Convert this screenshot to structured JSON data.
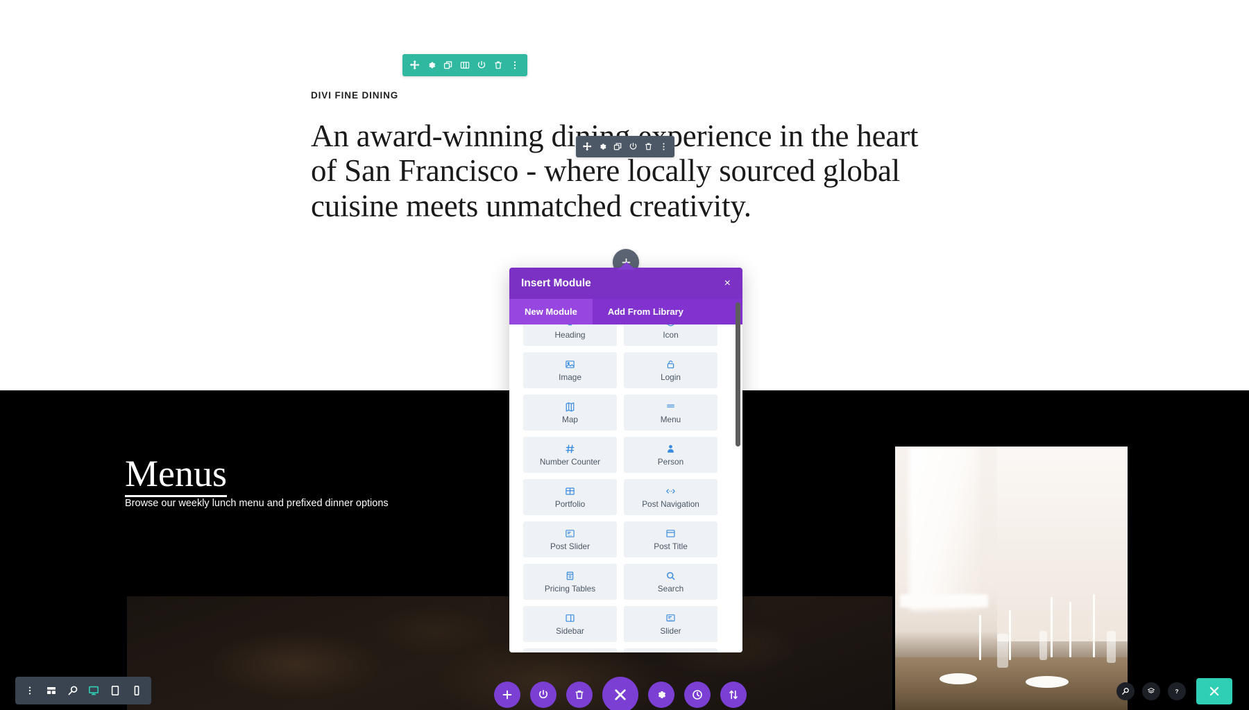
{
  "hero": {
    "eyebrow": "DIVI FINE DINING",
    "headline": "An award-winning dining experience in the heart of San Francisco - where locally sourced global cuisine meets unmatched creativity."
  },
  "dark_section": {
    "title": "Menus",
    "subtitle": "Browse our weekly lunch menu and prefixed dinner options"
  },
  "section_toolbar": {
    "buttons": [
      {
        "icon": "move-icon",
        "label": "Move Section"
      },
      {
        "icon": "gear-icon",
        "label": "Section Settings"
      },
      {
        "icon": "duplicate-icon",
        "label": "Duplicate Section"
      },
      {
        "icon": "columns-icon",
        "label": "Column Structure"
      },
      {
        "icon": "power-icon",
        "label": "Disable Section"
      },
      {
        "icon": "trash-icon",
        "label": "Delete Section"
      },
      {
        "icon": "more-options-icon",
        "label": "More Options"
      }
    ]
  },
  "module_toolbar": {
    "buttons": [
      {
        "icon": "move-icon",
        "label": "Move Module"
      },
      {
        "icon": "gear-icon",
        "label": "Module Settings"
      },
      {
        "icon": "duplicate-icon",
        "label": "Duplicate Module"
      },
      {
        "icon": "power-icon",
        "label": "Disable Module"
      },
      {
        "icon": "trash-icon",
        "label": "Delete Module"
      },
      {
        "icon": "more-options-icon",
        "label": "More Options"
      }
    ]
  },
  "add_module_button": {
    "icon": "plus-icon",
    "label": "Add New Module"
  },
  "modal": {
    "title": "Insert Module",
    "close_label": "×",
    "close_icon": "close-icon",
    "tabs": [
      {
        "label": "New Module",
        "active": true
      },
      {
        "label": "Add From Library",
        "active": false
      }
    ],
    "modules": [
      {
        "label": "Heading",
        "icon": "heading-icon"
      },
      {
        "label": "Icon",
        "icon": "icon-badge-icon"
      },
      {
        "label": "Image",
        "icon": "image-icon"
      },
      {
        "label": "Login",
        "icon": "lock-icon"
      },
      {
        "label": "Map",
        "icon": "map-icon"
      },
      {
        "label": "Menu",
        "icon": "hamburger-icon"
      },
      {
        "label": "Number Counter",
        "icon": "hash-icon"
      },
      {
        "label": "Person",
        "icon": "person-icon"
      },
      {
        "label": "Portfolio",
        "icon": "grid-icon"
      },
      {
        "label": "Post Navigation",
        "icon": "code-arrows-icon"
      },
      {
        "label": "Post Slider",
        "icon": "post-slider-icon"
      },
      {
        "label": "Post Title",
        "icon": "post-title-icon"
      },
      {
        "label": "Pricing Tables",
        "icon": "pricing-icon"
      },
      {
        "label": "Search",
        "icon": "search-icon"
      },
      {
        "label": "Sidebar",
        "icon": "sidebar-icon"
      },
      {
        "label": "Slider",
        "icon": "slider-icon"
      },
      {
        "label": "",
        "icon": "person-add-icon"
      },
      {
        "label": "",
        "icon": "window-icon"
      }
    ]
  },
  "bottom_left_toolbar": {
    "buttons": [
      {
        "icon": "vertical-dots-icon",
        "label": "More Settings"
      },
      {
        "icon": "wireframe-icon",
        "label": "Wireframe View"
      },
      {
        "icon": "zoom-out-icon",
        "label": "Zoom Out View"
      },
      {
        "icon": "desktop-icon",
        "label": "Desktop View",
        "active": true
      },
      {
        "icon": "tablet-icon",
        "label": "Tablet View"
      },
      {
        "icon": "phone-icon",
        "label": "Phone View"
      }
    ]
  },
  "bottom_center_toolbar": {
    "buttons": [
      {
        "icon": "plus-icon",
        "label": "Add Section"
      },
      {
        "icon": "power-icon",
        "label": "Toggle Visibility"
      },
      {
        "icon": "trash-icon",
        "label": "Delete"
      },
      {
        "icon": "close-icon",
        "label": "Close Builder",
        "primary": true
      },
      {
        "icon": "gear-icon",
        "label": "Settings"
      },
      {
        "icon": "history-icon",
        "label": "Editing History"
      },
      {
        "icon": "sort-icon",
        "label": "Portability"
      }
    ]
  },
  "bottom_right_toolbar": {
    "buttons": [
      {
        "icon": "zoom-icon",
        "label": "Search"
      },
      {
        "icon": "layers-icon",
        "label": "Layers"
      },
      {
        "icon": "help-icon",
        "label": "Help"
      }
    ],
    "close_button": {
      "icon": "close-icon",
      "label": "Close"
    }
  },
  "colors": {
    "brand_purple": "#7b31c4",
    "tab_active": "#9747e0",
    "teal": "#2fcfb5",
    "toolbar_dark": "#4c5866",
    "module_icon_blue": "#3b8ce0"
  }
}
